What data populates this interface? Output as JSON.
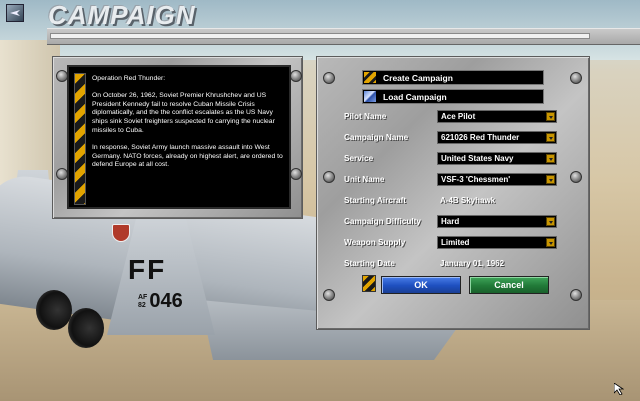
{
  "window": {
    "title": "CAMPAIGN",
    "icon": "aircraft-icon"
  },
  "aircraft_markings": {
    "tail_code": "FF",
    "serial_prefix_top": "AF",
    "serial_prefix_bottom": "82",
    "serial": "046"
  },
  "briefing": {
    "paragraphs": [
      "Operation Red Thunder:",
      "On October 26, 1962, Soviet Premier Khrushchev and US President Kennedy fail to resolve Cuban Missile Crisis diplomatically, and the the conflict escalates as the US Navy ships sink Soviet freighters suspected fo carrying the nuclear missiles to Cuba.",
      "In response, Soviet Army launch massive assault into West Germany. NATO forces, already on highest alert, are ordered to defend Europe at all cost."
    ]
  },
  "actions": {
    "create": "Create Campaign",
    "load": "Load Campaign"
  },
  "fields": [
    {
      "label": "Pilot Name",
      "value": "Ace Pilot"
    },
    {
      "label": "Campaign Name",
      "value": "621026 Red Thunder"
    },
    {
      "label": "Service",
      "value": "United States Navy"
    },
    {
      "label": "Unit Name",
      "value": "VSF-3 'Chessmen'"
    }
  ],
  "starting_aircraft": {
    "label": "Starting Aircraft",
    "value": "A-4B Skyhawk"
  },
  "fields2": [
    {
      "label": "Campaign Difficulty",
      "value": "Hard"
    },
    {
      "label": "Weapon Supply",
      "value": "Limited"
    }
  ],
  "starting_date": {
    "label": "Starting Date",
    "value": "January 01, 1962"
  },
  "buttons": {
    "ok": "OK",
    "cancel": "Cancel"
  },
  "colors": {
    "ok": "#1e4fbf",
    "cancel": "#217a38",
    "hazard": "#e2a400"
  }
}
